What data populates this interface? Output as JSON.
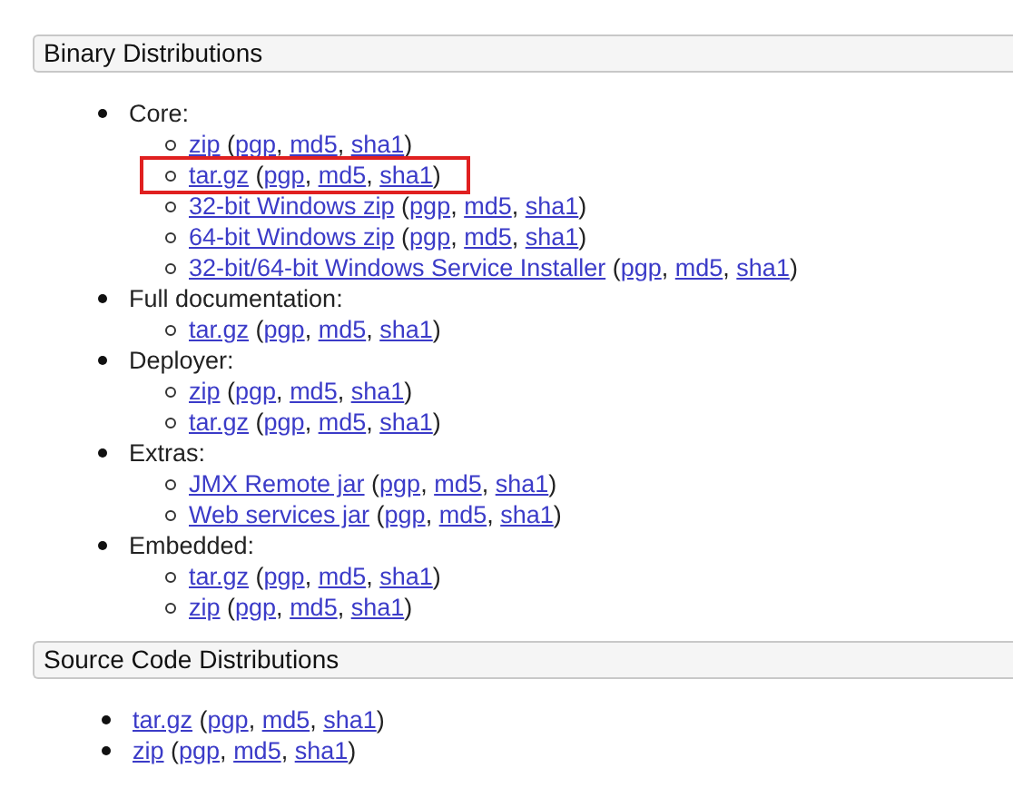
{
  "sections": [
    {
      "title": "Binary Distributions",
      "items": [
        {
          "kind": "group",
          "label": "Core:",
          "children": [
            {
              "label": "zip",
              "checksums": {
                "open": "(",
                "items": [
                  "pgp",
                  "md5",
                  "sha1"
                ],
                "separator": ",",
                "close": ")"
              },
              "highlighted": false
            },
            {
              "label": "tar.gz",
              "checksums": {
                "open": "(",
                "items": [
                  "pgp",
                  "md5",
                  "sha1"
                ],
                "separator": ",",
                "close": ")"
              },
              "highlighted": true
            },
            {
              "label": "32-bit Windows zip",
              "checksums": {
                "open": "(",
                "items": [
                  "pgp",
                  "md5",
                  "sha1"
                ],
                "separator": ",",
                "close": ")"
              },
              "highlighted": false
            },
            {
              "label": "64-bit Windows zip",
              "checksums": {
                "open": "(",
                "items": [
                  "pgp",
                  "md5",
                  "sha1"
                ],
                "separator": ",",
                "close": ")"
              },
              "highlighted": false
            },
            {
              "label": "32-bit/64-bit Windows Service Installer",
              "checksums": {
                "open": "(",
                "items": [
                  "pgp",
                  "md5",
                  "sha1"
                ],
                "separator": ",",
                "close": ")"
              },
              "highlighted": false
            }
          ]
        },
        {
          "kind": "group",
          "label": "Full documentation:",
          "children": [
            {
              "label": "tar.gz",
              "checksums": {
                "open": "(",
                "items": [
                  "pgp",
                  "md5",
                  "sha1"
                ],
                "separator": ",",
                "close": ")"
              },
              "highlighted": false
            }
          ]
        },
        {
          "kind": "group",
          "label": "Deployer:",
          "children": [
            {
              "label": "zip",
              "checksums": {
                "open": "(",
                "items": [
                  "pgp",
                  "md5",
                  "sha1"
                ],
                "separator": ",",
                "close": ")"
              },
              "highlighted": false
            },
            {
              "label": "tar.gz",
              "checksums": {
                "open": "(",
                "items": [
                  "pgp",
                  "md5",
                  "sha1"
                ],
                "separator": ",",
                "close": ")"
              },
              "highlighted": false
            }
          ]
        },
        {
          "kind": "group",
          "label": "Extras:",
          "children": [
            {
              "label": "JMX Remote jar",
              "checksums": {
                "open": "(",
                "items": [
                  "pgp",
                  "md5",
                  "sha1"
                ],
                "separator": ",",
                "close": ")"
              },
              "highlighted": false
            },
            {
              "label": "Web services jar",
              "checksums": {
                "open": "(",
                "items": [
                  "pgp",
                  "md5",
                  "sha1"
                ],
                "separator": ",",
                "close": ")"
              },
              "highlighted": false
            }
          ]
        },
        {
          "kind": "group",
          "label": "Embedded:",
          "children": [
            {
              "label": "tar.gz",
              "checksums": {
                "open": "(",
                "items": [
                  "pgp",
                  "md5",
                  "sha1"
                ],
                "separator": ",",
                "close": ")"
              },
              "highlighted": false
            },
            {
              "label": "zip",
              "checksums": {
                "open": "(",
                "items": [
                  "pgp",
                  "md5",
                  "sha1"
                ],
                "separator": ",",
                "close": ")"
              },
              "highlighted": false
            }
          ]
        }
      ]
    },
    {
      "title": "Source Code Distributions",
      "items": [
        {
          "kind": "link",
          "label": "tar.gz",
          "checksums": {
            "open": "(",
            "items": [
              "pgp",
              "md5",
              "sha1"
            ],
            "separator": ",",
            "close": ")"
          },
          "highlighted": false
        },
        {
          "kind": "link",
          "label": "zip",
          "checksums": {
            "open": "(",
            "items": [
              "pgp",
              "md5",
              "sha1"
            ],
            "separator": ",",
            "close": ")"
          },
          "highlighted": false
        }
      ]
    }
  ]
}
